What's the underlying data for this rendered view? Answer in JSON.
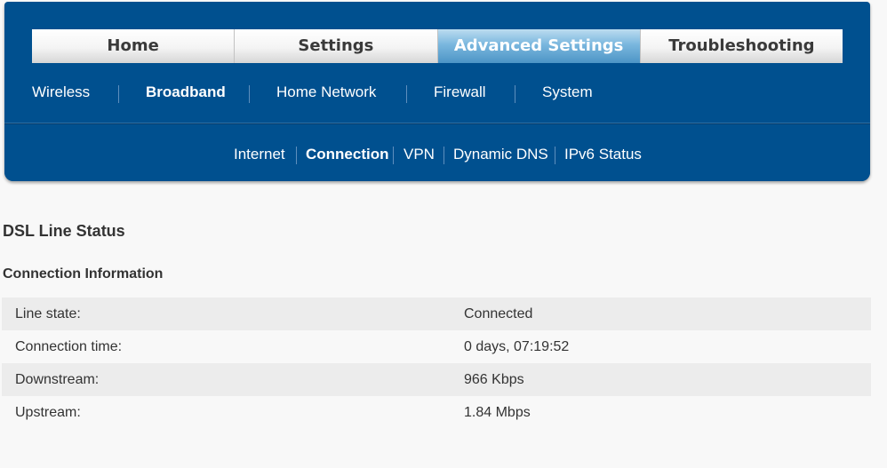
{
  "top_tabs": [
    {
      "label": "Home",
      "active": false
    },
    {
      "label": "Settings",
      "active": false
    },
    {
      "label": "Advanced Settings",
      "active": true
    },
    {
      "label": "Troubleshooting",
      "active": false
    }
  ],
  "sub_nav": [
    {
      "label": "Wireless",
      "active": false
    },
    {
      "label": "Broadband",
      "active": true
    },
    {
      "label": "Home Network",
      "active": false
    },
    {
      "label": "Firewall",
      "active": false
    },
    {
      "label": "System",
      "active": false
    }
  ],
  "third_nav": [
    {
      "label": "Internet",
      "active": false
    },
    {
      "label": "Connection",
      "active": true
    },
    {
      "label": "VPN",
      "active": false
    },
    {
      "label": "Dynamic DNS",
      "active": false
    },
    {
      "label": "IPv6 Status",
      "active": false
    }
  ],
  "page": {
    "title": "DSL Line Status",
    "section_title": "Connection Information"
  },
  "connection_info": [
    {
      "label": "Line state:",
      "value": "Connected"
    },
    {
      "label": "Connection time:",
      "value": "0 days, 07:19:52"
    },
    {
      "label": "Downstream:",
      "value": "966 Kbps"
    },
    {
      "label": "Upstream:",
      "value": "1.84 Mbps"
    }
  ],
  "colors": {
    "nav_blue": "#00508f",
    "active_tab_blue": "#7ab7de",
    "row_stripe": "#ececec",
    "page_background": "#f8f8f8"
  }
}
